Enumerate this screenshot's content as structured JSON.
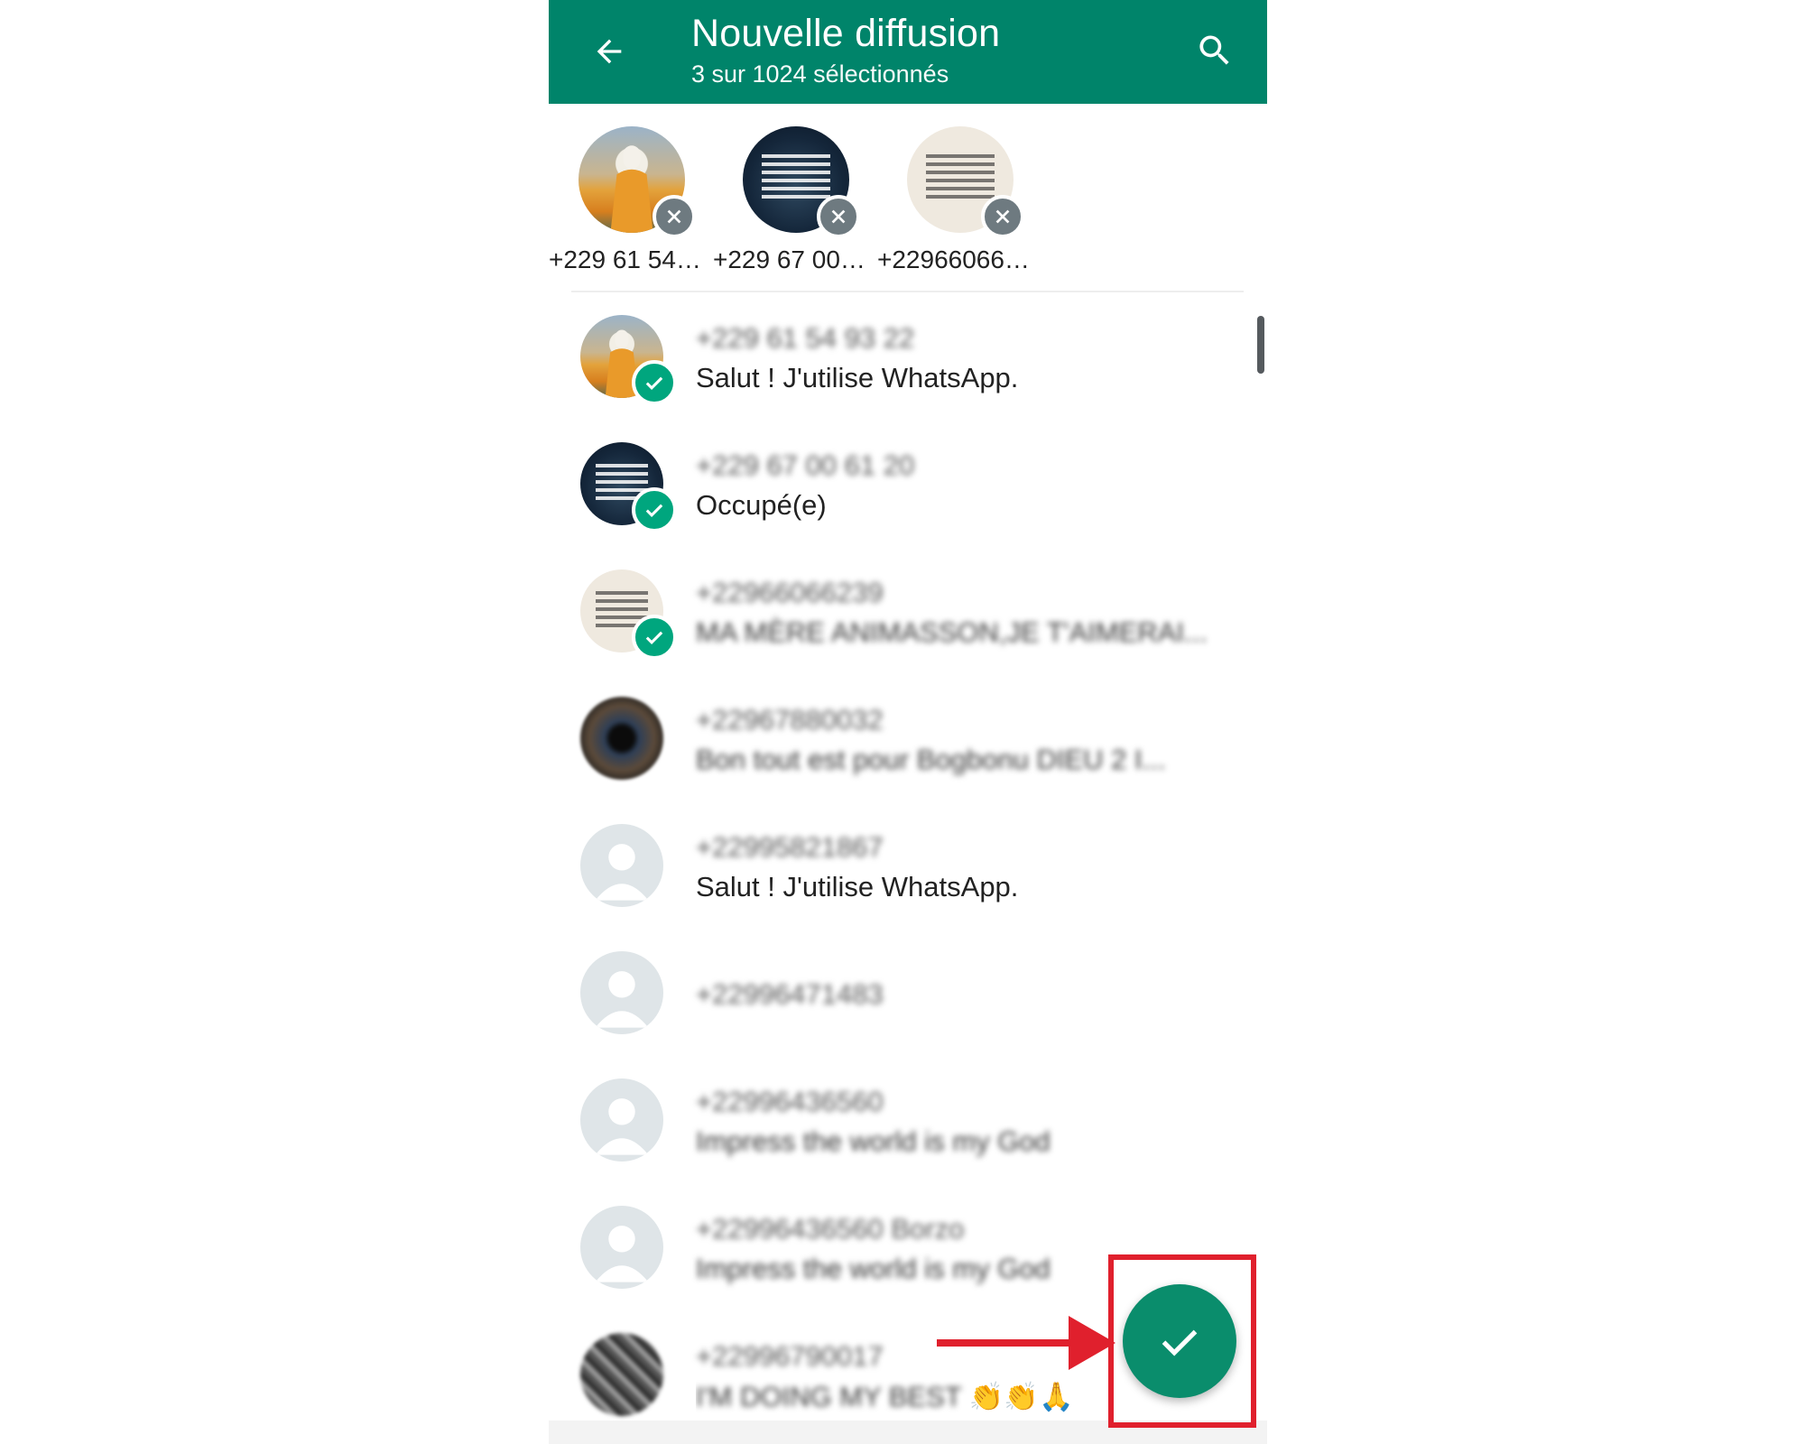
{
  "appbar": {
    "title": "Nouvelle diffusion",
    "subtitle": "3 sur 1024 sélectionnés",
    "back_icon": "arrow-left-icon",
    "search_icon": "search-icon",
    "background": "#00846a"
  },
  "selected_chips": [
    {
      "name": "+229 61 54…",
      "avatar": "photo-person-orange"
    },
    {
      "name": "+229 67 00…",
      "avatar": "photo-dark-quote"
    },
    {
      "name": "+22966066…",
      "avatar": "photo-paper-quote"
    }
  ],
  "contacts": [
    {
      "line1": "+229 61 54 93 22",
      "line2": "Salut ! J'utilise WhatsApp.",
      "line1_blurred": true,
      "line2_blurred": false,
      "selected": true,
      "avatar": "photo-person-orange"
    },
    {
      "line1": "+229 67 00 61 20",
      "line2": "Occupé(e)",
      "line1_blurred": true,
      "line2_blurred": false,
      "selected": true,
      "avatar": "photo-dark-quote"
    },
    {
      "line1": "+22966066239",
      "line2": "MA MÈRE ANIMASSON,JE T'AIMERAI...",
      "line1_blurred": true,
      "line2_blurred": true,
      "selected": true,
      "avatar": "photo-paper-quote"
    },
    {
      "line1": "+22967880032",
      "line2": "Bon tout est pour Bogbonu DIEU 2 I...",
      "line1_blurred": true,
      "line2_blurred": true,
      "selected": false,
      "avatar": "photo-eye"
    },
    {
      "line1": "+22995821867",
      "line2": "Salut ! J'utilise WhatsApp.",
      "line1_blurred": true,
      "line2_blurred": false,
      "selected": false,
      "avatar": "default-avatar"
    },
    {
      "line1": "+22996471483",
      "line2": "",
      "line1_blurred": true,
      "line2_blurred": false,
      "selected": false,
      "avatar": "default-avatar"
    },
    {
      "line1": "+22996436560",
      "line2": "Impress the world is my God",
      "line1_blurred": true,
      "line2_blurred": true,
      "selected": false,
      "avatar": "default-avatar"
    },
    {
      "line1": "+22996436560 Borzo",
      "line2": "Impress the world is my God",
      "line1_blurred": true,
      "line2_blurred": true,
      "selected": false,
      "avatar": "default-avatar"
    },
    {
      "line1": "+22996790017",
      "line2": "I'M DOING MY BEST",
      "line2_emoji": "👏👏🙏",
      "line1_blurred": true,
      "line2_blurred": true,
      "selected": false,
      "avatar": "photo-noise"
    }
  ],
  "fab": {
    "icon": "check-icon",
    "color": "#0a8d6c"
  },
  "annotation": {
    "color": "#e0202d",
    "arrow_icon": "arrow-right-icon"
  }
}
